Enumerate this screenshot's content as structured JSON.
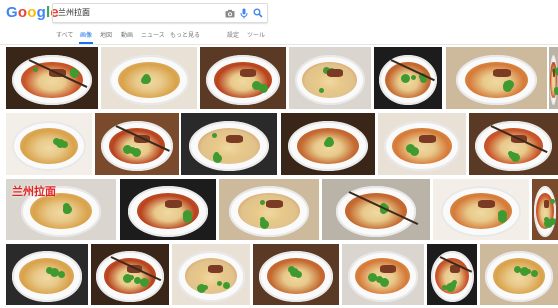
{
  "logo": {
    "letters": [
      {
        "char": "G",
        "color": "#4285F4"
      },
      {
        "char": "o",
        "color": "#EA4335"
      },
      {
        "char": "o",
        "color": "#FBBC05"
      },
      {
        "char": "g",
        "color": "#4285F4"
      },
      {
        "char": "l",
        "color": "#34A853"
      },
      {
        "char": "e",
        "color": "#EA4335"
      }
    ]
  },
  "search": {
    "query": "兰州拉面"
  },
  "tabs": [
    {
      "label": "すべて",
      "active": false
    },
    {
      "label": "画像",
      "active": true
    },
    {
      "label": "地図",
      "active": false
    },
    {
      "label": "動画",
      "active": false
    },
    {
      "label": "ニュース",
      "active": false
    },
    {
      "label": "もっと見る",
      "active": false
    },
    {
      "label": "設定",
      "active": false
    },
    {
      "label": "ツール",
      "active": false
    }
  ],
  "image_label": "兰州拉面",
  "colors": {
    "accent": "#1a73e8",
    "broth": "#c9572b",
    "herb": "#3f9a2f",
    "noodle": "#f0d9a2"
  }
}
